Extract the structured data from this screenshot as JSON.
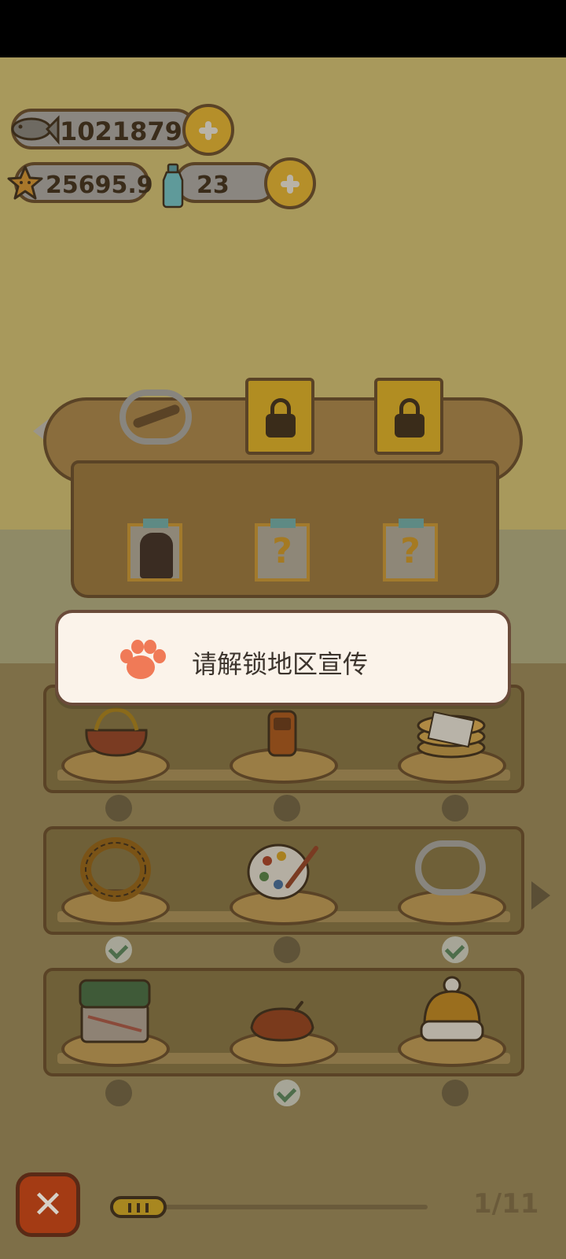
{
  "currencies": {
    "fish": "1021879",
    "star": "25695.9",
    "bottle": "23"
  },
  "counter": {
    "slots": [
      {
        "item": "bear-trap",
        "locked": false,
        "card": "bear"
      },
      {
        "item": "lock",
        "locked": true,
        "card": "?"
      },
      {
        "item": "lock",
        "locked": true,
        "card": "?"
      }
    ]
  },
  "toast": {
    "message": "请解锁地区宣传"
  },
  "shelves": [
    {
      "items": [
        {
          "name": "coin-purse",
          "status": "empty"
        },
        {
          "name": "flip-phone",
          "status": "empty"
        },
        {
          "name": "pancake-stack",
          "status": "empty"
        }
      ]
    },
    {
      "items": [
        {
          "name": "wreath",
          "status": "checked"
        },
        {
          "name": "paint-palette",
          "status": "empty"
        },
        {
          "name": "bear-trap",
          "status": "checked"
        }
      ]
    },
    {
      "items": [
        {
          "name": "sushi-box",
          "status": "empty"
        },
        {
          "name": "beret",
          "status": "checked"
        },
        {
          "name": "beanie",
          "status": "empty"
        }
      ]
    }
  ],
  "bottom_bar": {
    "close_label": "✕",
    "page_indicator": "1/11",
    "current_page": 1,
    "total_pages": 11
  }
}
